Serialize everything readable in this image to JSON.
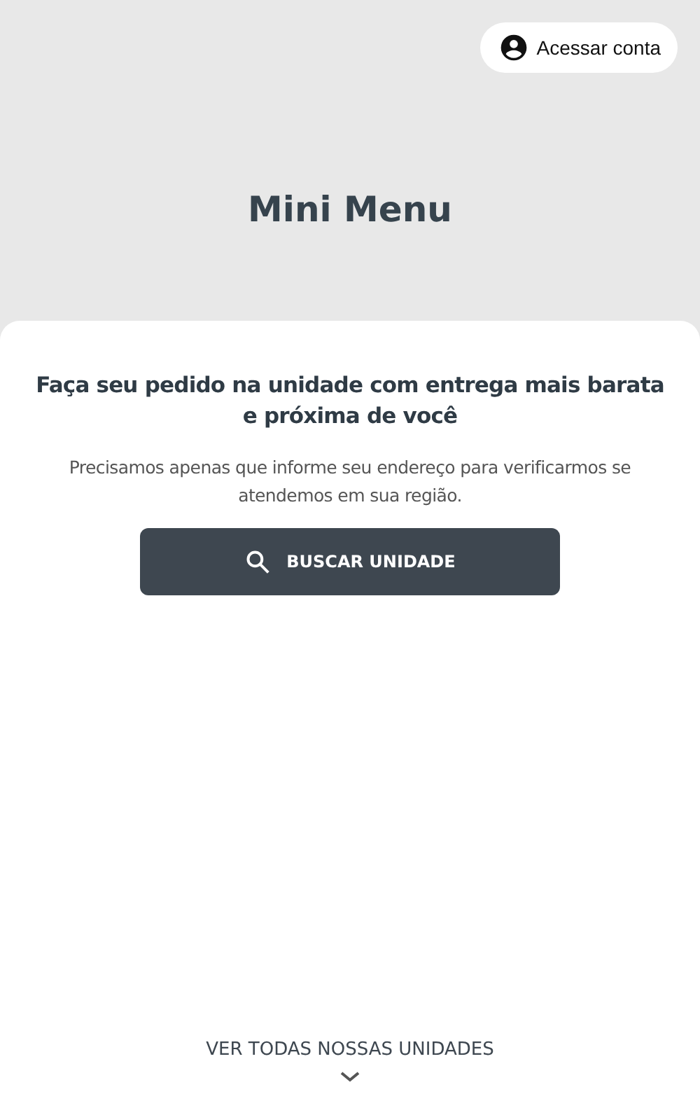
{
  "account_button": {
    "label": "Acessar conta"
  },
  "brand": {
    "title": "Mini Menu"
  },
  "card": {
    "heading": "Faça seu pedido na unidade com entrega mais barata e próxima de você",
    "description": "Precisamos apenas que informe seu endereço para verificarmos se atendemos em sua região.",
    "search_button": {
      "label": "BUSCAR UNIDADE"
    }
  },
  "footer_link": {
    "label": "VER TODAS NOSSAS UNIDADES"
  }
}
